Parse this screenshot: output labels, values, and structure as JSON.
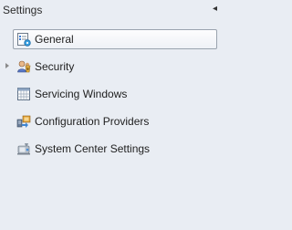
{
  "panel": {
    "title": "Settings",
    "collapse_icon": "chevron-left-icon"
  },
  "nav": {
    "items": [
      {
        "label": "General",
        "icon": "general-settings-icon",
        "selected": true
      },
      {
        "label": "Security",
        "icon": "security-users-icon",
        "expandable": true
      },
      {
        "label": "Servicing Windows",
        "icon": "calendar-grid-icon"
      },
      {
        "label": "Configuration Providers",
        "icon": "configuration-providers-icon"
      },
      {
        "label": "System Center Settings",
        "icon": "system-center-icon"
      }
    ]
  }
}
